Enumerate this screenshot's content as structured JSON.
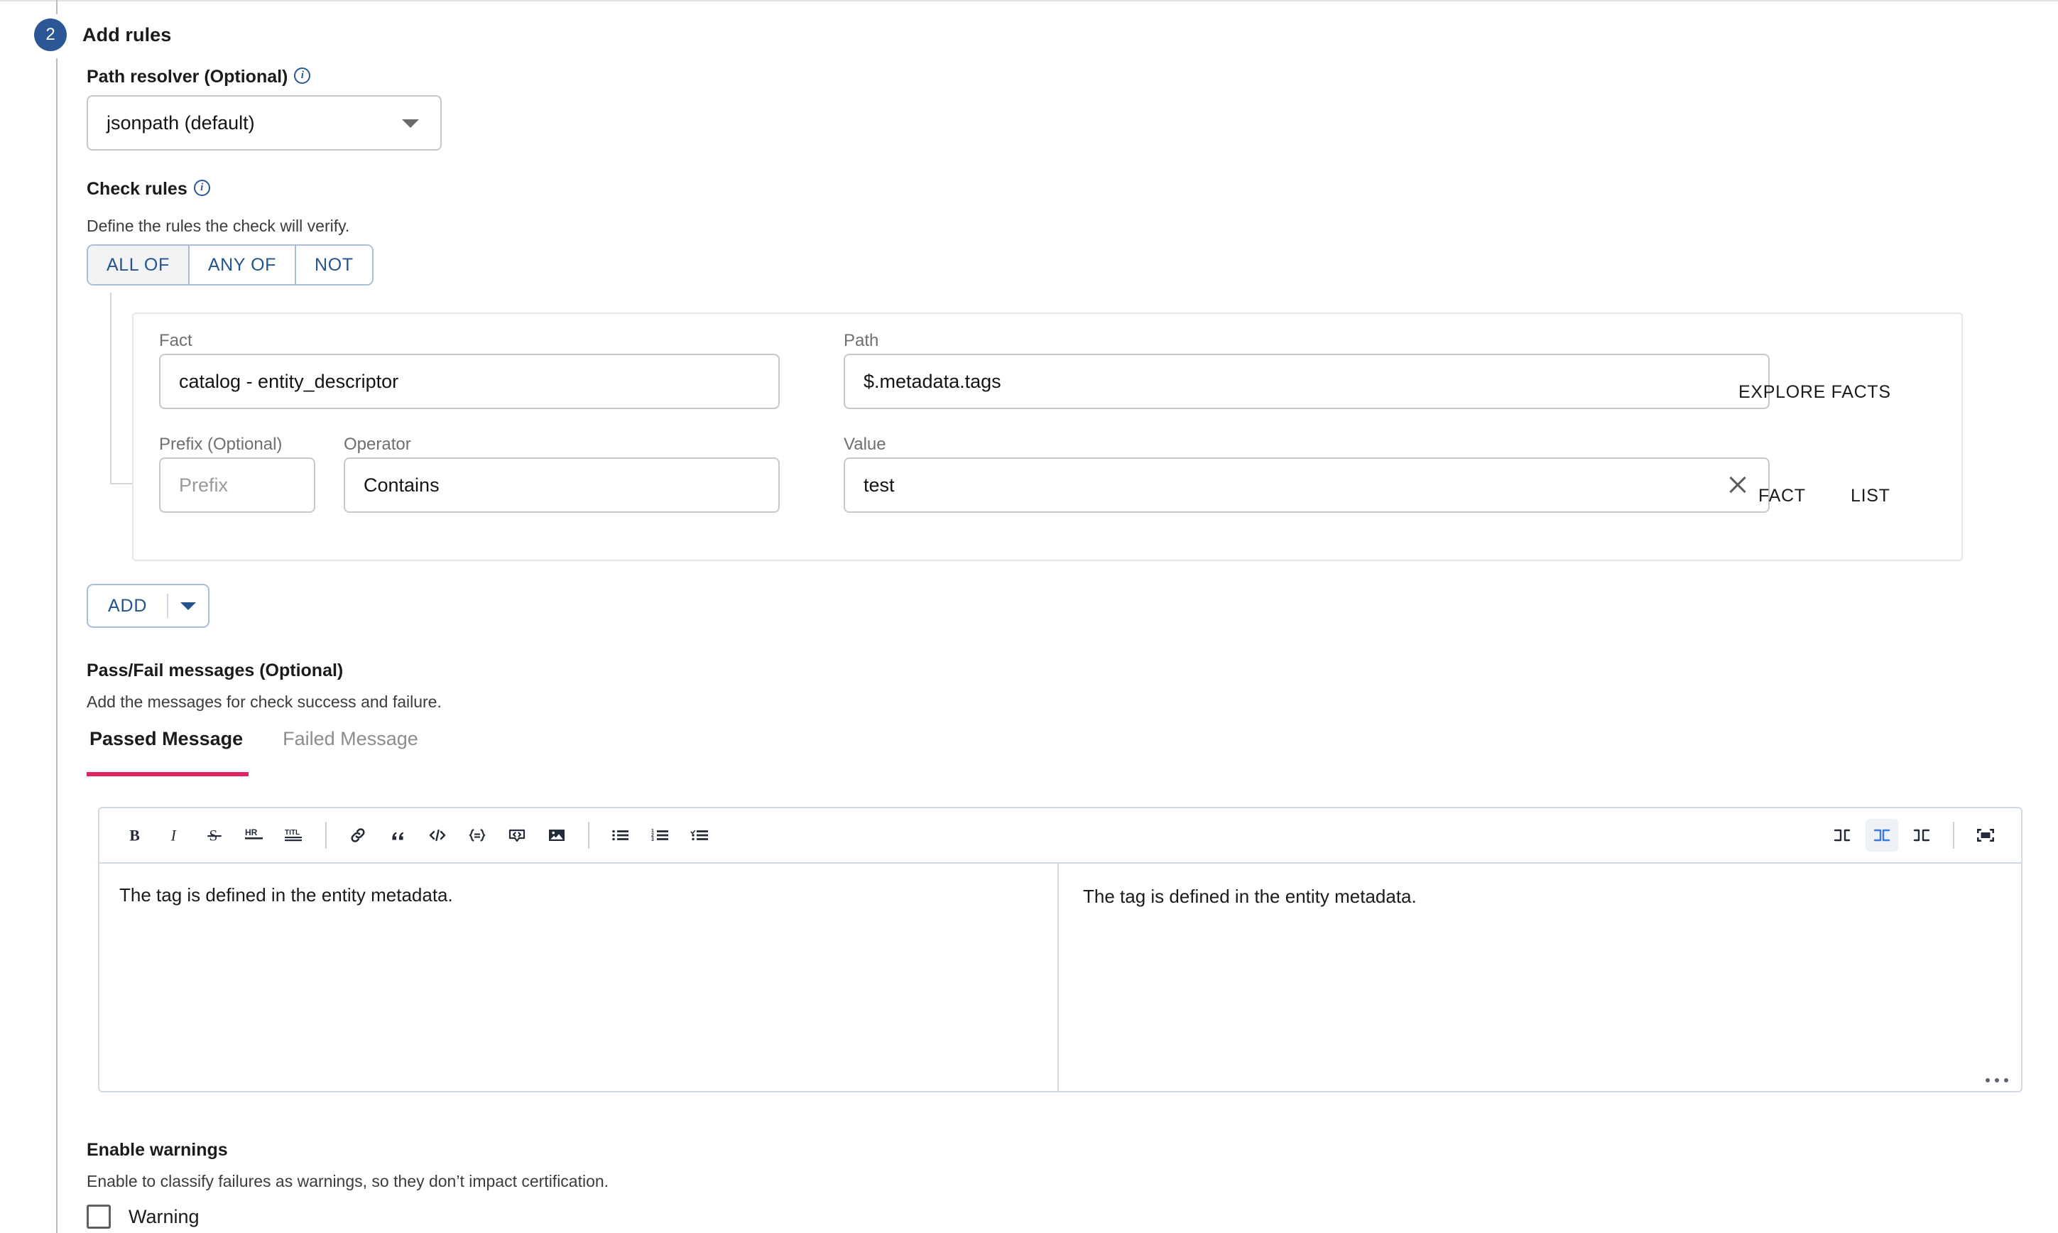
{
  "step": {
    "number": "2",
    "title": "Add rules"
  },
  "path_resolver": {
    "label": "Path resolver (Optional)",
    "info_icon": "info-icon",
    "value": "jsonpath (default)",
    "caret_icon": "chevron-down-icon"
  },
  "check_rules": {
    "label": "Check rules",
    "info_icon": "info-icon",
    "description": "Define the rules the check will verify.",
    "operators": [
      {
        "label": "ALL OF",
        "active": true
      },
      {
        "label": "ANY OF",
        "active": false
      },
      {
        "label": "NOT",
        "active": false
      }
    ]
  },
  "rule": {
    "fact_label": "Fact",
    "fact_value": "catalog - entity_descriptor",
    "path_label": "Path",
    "path_value": "$.metadata.tags",
    "explore_facts_label": "EXPLORE FACTS",
    "prefix_label": "Prefix (Optional)",
    "prefix_placeholder": "Prefix",
    "operator_label": "Operator",
    "operator_value": "Contains",
    "value_label": "Value",
    "value_value": "test",
    "clear_icon": "close-icon",
    "fact_button_label": "FACT",
    "list_button_label": "LIST"
  },
  "add_button": {
    "label": "ADD",
    "caret_icon": "chevron-down-icon"
  },
  "pass_fail": {
    "label": "Pass/Fail messages (Optional)",
    "description": "Add the messages for check success and failure.",
    "tabs": [
      {
        "label": "Passed Message",
        "active": true
      },
      {
        "label": "Failed Message",
        "active": false
      }
    ]
  },
  "editor": {
    "toolbar": [
      {
        "name": "bold-icon",
        "title": "Bold"
      },
      {
        "name": "italic-icon",
        "title": "Italic"
      },
      {
        "name": "strikethrough-icon",
        "title": "Strikethrough"
      },
      {
        "name": "horizontal-rule-icon",
        "title": "HR"
      },
      {
        "name": "title-icon",
        "title": "Title"
      },
      {
        "name": "link-icon",
        "title": "Link"
      },
      {
        "name": "quote-icon",
        "title": "Quote"
      },
      {
        "name": "code-icon",
        "title": "Code"
      },
      {
        "name": "code-block-icon",
        "title": "Code block"
      },
      {
        "name": "comment-code-icon",
        "title": "Embed"
      },
      {
        "name": "image-icon",
        "title": "Image"
      },
      {
        "name": "bullet-list-icon",
        "title": "Unordered list"
      },
      {
        "name": "ordered-list-icon",
        "title": "Ordered list"
      },
      {
        "name": "checklist-icon",
        "title": "Checked list"
      },
      {
        "name": "edit-mode-icon",
        "title": "Write only"
      },
      {
        "name": "split-mode-icon",
        "title": "Split view",
        "active": true
      },
      {
        "name": "preview-mode-icon",
        "title": "Preview only"
      },
      {
        "name": "fullscreen-icon",
        "title": "Fullscreen"
      }
    ],
    "write_text": "The tag is defined in the entity metadata.",
    "preview_text": "The tag is defined in the entity metadata.",
    "resize_handle": "resize-grip-icon"
  },
  "warnings": {
    "label": "Enable warnings",
    "description": "Enable to classify failures as warnings, so they don’t impact certification.",
    "checkbox_label": "Warning",
    "checked": false
  },
  "colors": {
    "step_badge": "#2b5797",
    "accent_link": "#24548f",
    "tab_underline": "#e0225e",
    "toolbar_active": "#3b78e7"
  }
}
